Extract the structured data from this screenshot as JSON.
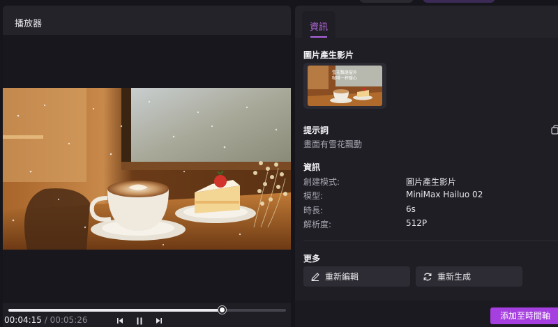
{
  "player": {
    "title": "播放器",
    "current_time": "00:04:15",
    "separator": "/",
    "total_time": "00:05:26",
    "progress": 0.77,
    "controls": [
      "previous-frame-icon",
      "pause-icon",
      "next-frame-icon"
    ]
  },
  "info": {
    "tab_label": "資訊",
    "source_section": "圖片產生影片",
    "thumbnail_caption_line1": "雪花飄落窗外",
    "thumbnail_caption_line2": "咖啡一杯暖心",
    "prompt_title": "提示詞",
    "prompt_text": "畫面有雪花飄動",
    "details_title": "資訊",
    "details": [
      {
        "key": "創建模式:",
        "value": "圖片產生影片"
      },
      {
        "key": "模型:",
        "value": "MiniMax Hailuo 02"
      },
      {
        "key": "時長:",
        "value": "6s"
      },
      {
        "key": "解析度:",
        "value": "512P"
      }
    ],
    "more_title": "更多",
    "reedit_label": "重新編輯",
    "regenerate_label": "重新生成",
    "add_to_timeline_label": "添加至時間軸"
  },
  "colors": {
    "accent": "#a63fe0",
    "tab_active": "#c06ae6",
    "panel_bg": "#1f1e25"
  }
}
